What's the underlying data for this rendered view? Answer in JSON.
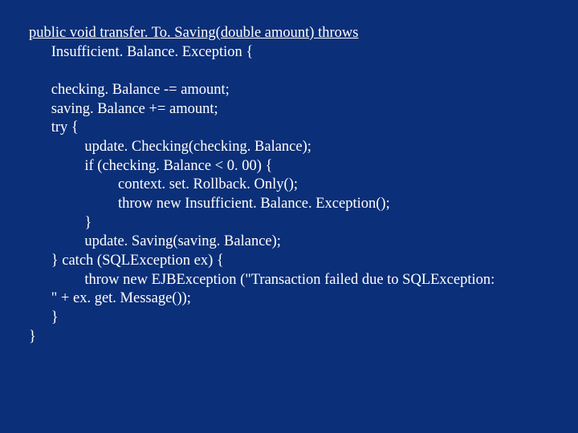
{
  "code": {
    "l1": "public void transfer. To. Saving(double amount) throws",
    "l2": "Insufficient. Balance. Exception {",
    "l3": "checking. Balance -= amount;",
    "l4": "saving. Balance += amount;",
    "l5": "try {",
    "l6": "update. Checking(checking. Balance);",
    "l7": "if (checking. Balance < 0. 00) {",
    "l8": "context. set. Rollback. Only();",
    "l9": "throw new Insufficient. Balance. Exception();",
    "l10": "}",
    "l11": "update. Saving(saving. Balance);",
    "l12": "} catch (SQLException ex) {",
    "l13": "throw new EJBException (\"Transaction failed due to SQLException:",
    "l14": "\" + ex. get. Message());",
    "l15": "}",
    "l16": "}"
  }
}
